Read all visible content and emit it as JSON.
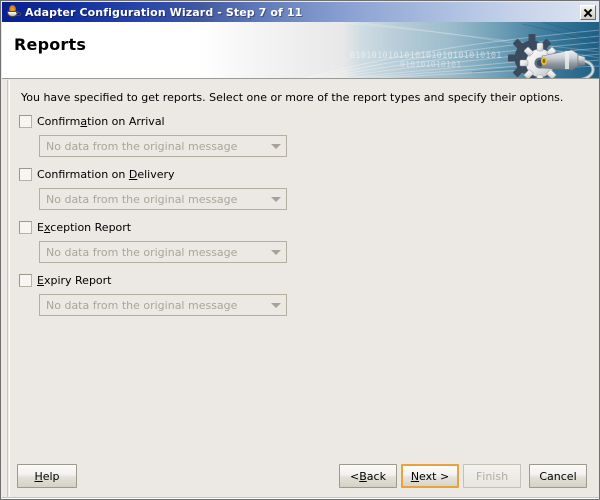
{
  "window": {
    "title": "Adapter Configuration Wizard - Step 7 of 11",
    "icon": "java-coffee-cup-icon",
    "close_label": "×"
  },
  "banner": {
    "title": "Reports",
    "decoration_text": "0101010101010101010101010101",
    "decoration_text_2": "010101010101"
  },
  "content": {
    "instruction": "You have specified to get reports.  Select one or more of the report types and specify their options.",
    "reports": [
      {
        "label_before": "Confirm",
        "mnemonic": "a",
        "label_after": "tion on Arrival",
        "full_label": "Confirmation on Arrival",
        "checked": false,
        "combo_value": "No data from the original message",
        "combo_enabled": false
      },
      {
        "label_before": "Confirmation on ",
        "mnemonic": "D",
        "label_after": "elivery",
        "full_label": "Confirmation on Delivery",
        "checked": false,
        "combo_value": "No data from the original message",
        "combo_enabled": false
      },
      {
        "label_before": "E",
        "mnemonic": "x",
        "label_after": "ception Report",
        "full_label": "Exception Report",
        "checked": false,
        "combo_value": "No data from the original message",
        "combo_enabled": false
      },
      {
        "label_before": "",
        "mnemonic": "E",
        "label_after": "xpiry Report",
        "full_label": "Expiry Report",
        "checked": false,
        "combo_value": "No data from the original message",
        "combo_enabled": false
      }
    ]
  },
  "buttons": {
    "help": {
      "before": "",
      "mnemonic": "H",
      "after": "elp",
      "full": "Help",
      "enabled": true,
      "focused": false
    },
    "back": {
      "before": "< ",
      "mnemonic": "B",
      "after": "ack",
      "full": "< Back",
      "enabled": true,
      "focused": false
    },
    "next": {
      "before": "",
      "mnemonic": "N",
      "after": "ext >",
      "full": "Next >",
      "enabled": true,
      "focused": true
    },
    "finish": {
      "before": "",
      "mnemonic": "F",
      "after": "inish",
      "full": "Finish",
      "enabled": false,
      "focused": false
    },
    "cancel": {
      "before": "",
      "mnemonic": "C",
      "after": "ancel",
      "full": "Cancel",
      "enabled": true,
      "focused": false
    }
  },
  "colors": {
    "titlebar_start": "#0a1f8c",
    "titlebar_end": "#dfe6f2",
    "panel_bg": "#ece9e4",
    "focus_border": "#e8a33d",
    "disabled_text": "#b0ada2",
    "combo_text": "#a8a698"
  }
}
